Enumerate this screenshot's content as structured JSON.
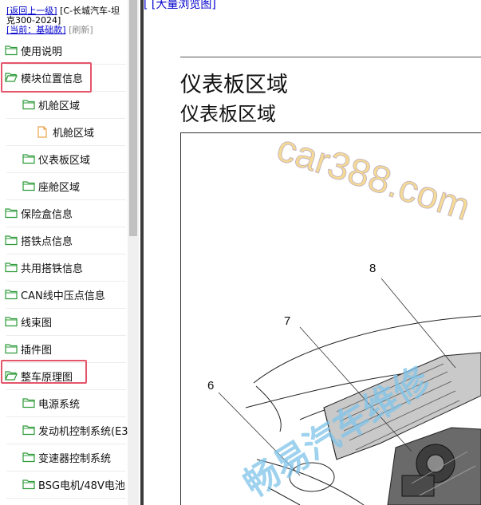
{
  "sidebar": {
    "back_link": "[返回上一级]",
    "vehicle": "[C-长城汽车-坦克300-2024]",
    "current": "[当前：基础款]",
    "refresh": "[刷新]",
    "items": [
      {
        "label": "使用说明",
        "icon": "folder-icon",
        "level": 0
      },
      {
        "label": "模块位置信息",
        "icon": "folder-open-icon",
        "level": 0
      },
      {
        "label": "机舱区域",
        "icon": "folder-icon",
        "level": 1
      },
      {
        "label": "机舱区域",
        "icon": "page-icon",
        "level": 2
      },
      {
        "label": "仪表板区域",
        "icon": "folder-icon",
        "level": 1
      },
      {
        "label": "座舱区域",
        "icon": "folder-icon",
        "level": 1
      },
      {
        "label": "保险盒信息",
        "icon": "folder-icon",
        "level": 0
      },
      {
        "label": "搭铁点信息",
        "icon": "folder-icon",
        "level": 0
      },
      {
        "label": "共用搭铁信息",
        "icon": "folder-icon",
        "level": 0
      },
      {
        "label": "CAN线中压点信息",
        "icon": "folder-icon",
        "level": 0
      },
      {
        "label": "线束图",
        "icon": "folder-icon",
        "level": 0
      },
      {
        "label": "插件图",
        "icon": "folder-icon",
        "level": 0
      },
      {
        "label": "整车原理图",
        "icon": "folder-open-icon",
        "level": 0
      },
      {
        "label": "电源系统",
        "icon": "folder-icon",
        "level": 1
      },
      {
        "label": "发动机控制系统(E3",
        "icon": "folder-icon",
        "level": 1
      },
      {
        "label": "变速器控制系统",
        "icon": "folder-icon",
        "level": 1
      },
      {
        "label": "BSG电机/48V电池",
        "icon": "folder-icon",
        "level": 1
      }
    ],
    "highlight_color": "#e5556a"
  },
  "content": {
    "top_link": "[ [大量浏览图]",
    "title": "仪表板区域",
    "subtitle": "仪表板区域",
    "figure": {
      "callouts": [
        "8",
        "7",
        "6"
      ],
      "watermark_1": "car388.com",
      "watermark_2": "畅易汽车维修"
    }
  }
}
